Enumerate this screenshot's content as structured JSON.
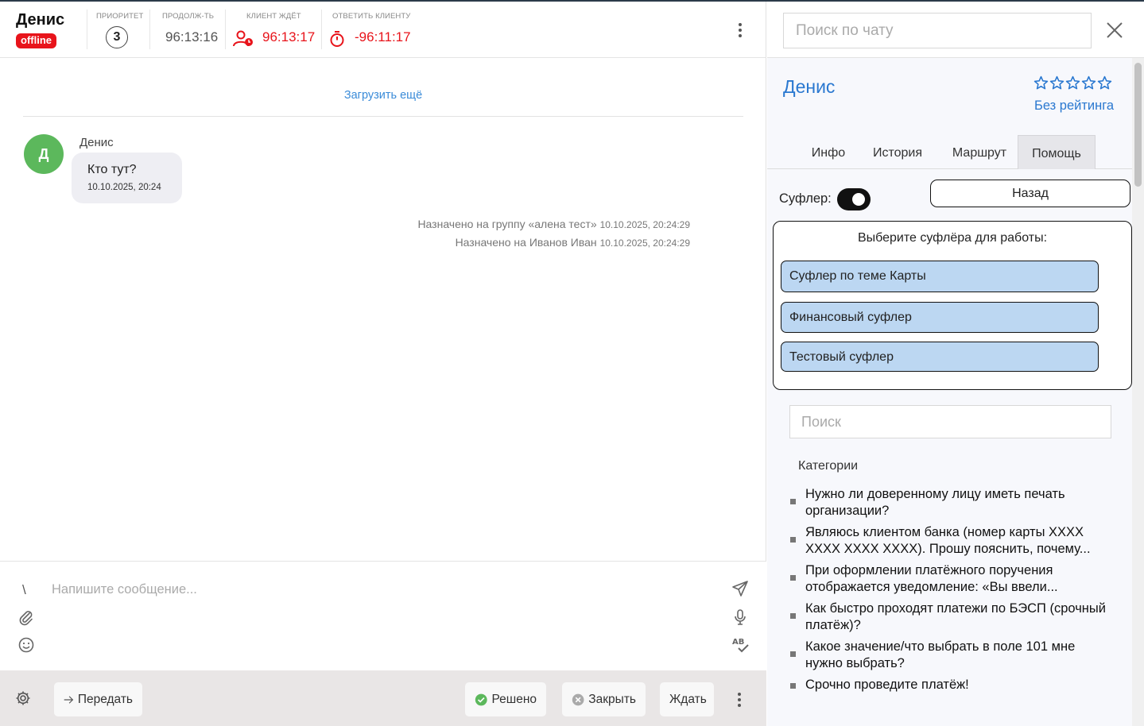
{
  "header": {
    "client_name": "Денис",
    "status": "offline",
    "metrics": [
      {
        "label": "ПРИОРИТЕТ",
        "value": "3"
      },
      {
        "label": "ПРОДОЛЖ-ТЬ",
        "value": "96:13:16"
      },
      {
        "label": "КЛИЕНТ ЖДЁТ",
        "value": "96:13:17"
      },
      {
        "label": "ОТВЕТИТЬ КЛИЕНТУ",
        "value": "-96:11:17"
      }
    ],
    "colors": {
      "status_red": "#e8141b"
    }
  },
  "chat": {
    "load_more": "Загрузить ещё",
    "message": {
      "avatar_letter": "Д",
      "avatar_color": "#5cb85c",
      "author": "Денис",
      "text": "Кто тут?",
      "time": "10.10.2025, 20:24"
    },
    "system_events": [
      {
        "text": "Назначено на группу «алена тест»",
        "time": "10.10.2025, 20:24:29"
      },
      {
        "text": "Назначено на Иванов Иван",
        "time": "10.10.2025, 20:24:29"
      }
    ]
  },
  "composer": {
    "placeholder": "Напишите сообщение...",
    "slash": "\\"
  },
  "footer": {
    "transfer": "Передать",
    "resolved": "Решено",
    "close": "Закрыть",
    "wait": "Ждать"
  },
  "sidebar": {
    "search_placeholder": "Поиск по чату",
    "client_name": "Денис",
    "rating_text": "Без рейтинга",
    "stars_filled": 0,
    "stars_total": 5,
    "tabs": [
      {
        "label": "Инфо",
        "active": false
      },
      {
        "label": "История",
        "active": false
      },
      {
        "label": "Маршрут",
        "active": false
      },
      {
        "label": "Помощь",
        "active": true
      }
    ],
    "sufler_label": "Суфлер:",
    "sufler_enabled": true,
    "back_button": "Назад",
    "sufler_title": "Выберите суфлёра для работы:",
    "sufler_options": [
      "Суфлер по теме Карты",
      "Финансовый суфлер",
      "Тестовый суфлер"
    ],
    "kb_search_placeholder": "Поиск",
    "categories_title": "Категории",
    "categories": [
      "Нужно ли доверенному лицу иметь печать организации?",
      "Являюсь клиентом банка (номер карты XXXX XXXX XXXX XXXX). Прошу пояснить, почему...",
      "При оформлении платёжного поручения отображается уведомление: «Вы ввели...",
      "Как быстро проходят платежи по БЭСП (срочный платёж)?",
      "Какое значение/что выбрать в поле 101 мне нужно выбрать?",
      "Срочно проведите платёж!"
    ],
    "colors": {
      "link_blue": "#2a78d0",
      "option_bg": "#bcd7f2"
    }
  }
}
